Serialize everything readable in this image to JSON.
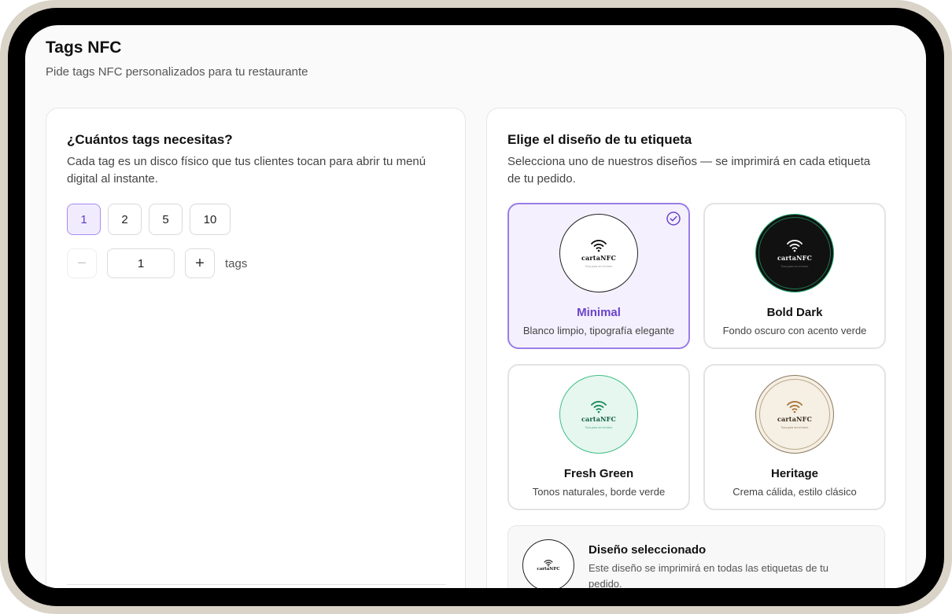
{
  "page": {
    "title": "Tags NFC",
    "subtitle": "Pide tags NFC personalizados para tu restaurante"
  },
  "quantity": {
    "title": "¿Cuántos tags necesitas?",
    "description": "Cada tag es un disco físico que tus clientes tocan para abrir tu menú digital al instante.",
    "options": [
      "1",
      "2",
      "5",
      "10"
    ],
    "selected_option": "1",
    "stepper": {
      "minus": "−",
      "plus": "+",
      "value": "1",
      "unit": "tags"
    }
  },
  "design": {
    "title": "Elige el diseño de tu etiqueta",
    "description": "Selecciona uno de nuestros diseños — se imprimirá en cada etiqueta de tu pedido.",
    "brand_text": "cartaNFC",
    "tiny_text": "Toca para ver el menú",
    "options": [
      {
        "name": "Minimal",
        "desc": "Blanco limpio, tipografía elegante",
        "selected": true,
        "style": "minimal"
      },
      {
        "name": "Bold Dark",
        "desc": "Fondo oscuro con acento verde",
        "selected": false,
        "style": "dark"
      },
      {
        "name": "Fresh Green",
        "desc": "Tonos naturales, borde verde",
        "selected": false,
        "style": "green"
      },
      {
        "name": "Heritage",
        "desc": "Crema cálida, estilo clásico",
        "selected": false,
        "style": "heritage"
      }
    ],
    "selected_panel": {
      "title": "Diseño seleccionado",
      "desc": "Este diseño se imprimirá en todas las etiquetas de tu pedido."
    }
  },
  "colors": {
    "accent": "#6b44c9",
    "accent_bg": "#f4f0fe",
    "green_accent": "#1fa56b",
    "heritage_accent": "#8d7b62"
  }
}
